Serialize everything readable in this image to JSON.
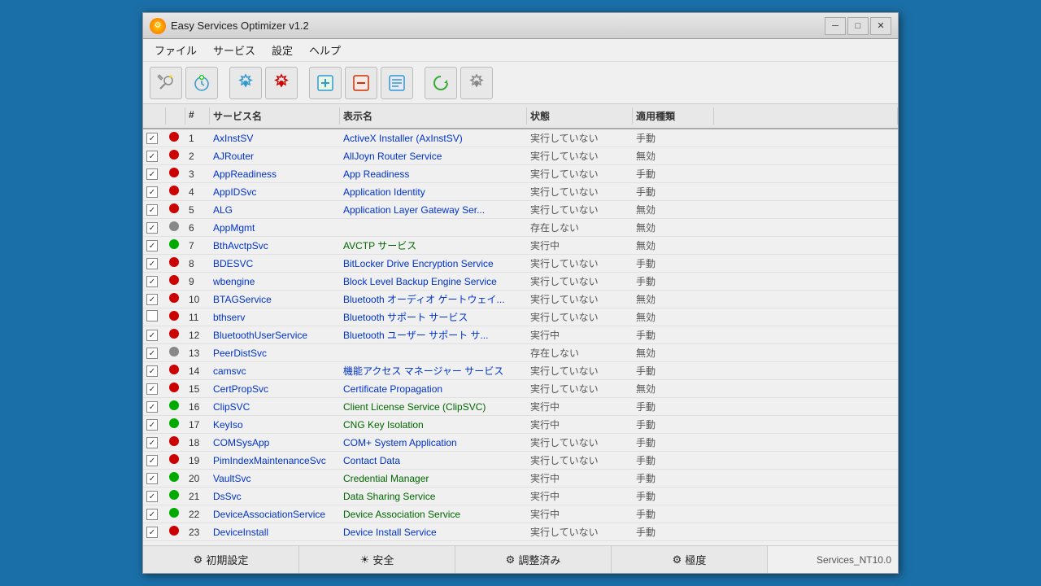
{
  "window": {
    "title": "Easy Services Optimizer v1.2",
    "icon": "⚙"
  },
  "titleButtons": {
    "minimize": "─",
    "maximize": "□",
    "close": "✕"
  },
  "menu": {
    "items": [
      "ファイル",
      "サービス",
      "設定",
      "ヘルプ"
    ]
  },
  "toolbar": {
    "buttons": [
      {
        "name": "wrench-star-icon",
        "symbol": "🔧",
        "label": "optimize"
      },
      {
        "name": "clock-icon",
        "symbol": "🕐",
        "label": "schedule"
      },
      {
        "name": "settings-icon",
        "symbol": "⚙",
        "label": "settings"
      },
      {
        "name": "settings-red-icon",
        "symbol": "🔴",
        "label": "settings-red"
      },
      {
        "name": "add-icon",
        "symbol": "➕",
        "label": "add"
      },
      {
        "name": "remove-icon",
        "symbol": "➖",
        "label": "remove"
      },
      {
        "name": "list-icon",
        "symbol": "📋",
        "label": "list"
      },
      {
        "name": "refresh-icon",
        "symbol": "🔄",
        "label": "refresh"
      },
      {
        "name": "gear-icon",
        "symbol": "⚙",
        "label": "gear"
      }
    ]
  },
  "table": {
    "headers": [
      "",
      "",
      "#",
      "サービス名",
      "表示名",
      "状態",
      "適用種類",
      ""
    ],
    "rows": [
      {
        "checked": true,
        "dot": "red",
        "num": "1",
        "service": "AxInstSV",
        "display": "ActiveX Installer (AxInstSV)",
        "status": "実行していない",
        "type": "手動",
        "green": false
      },
      {
        "checked": true,
        "dot": "red",
        "num": "2",
        "service": "AJRouter",
        "display": "AllJoyn Router Service",
        "status": "実行していない",
        "type": "無効",
        "green": false
      },
      {
        "checked": true,
        "dot": "red",
        "num": "3",
        "service": "AppReadiness",
        "display": "App Readiness",
        "status": "実行していない",
        "type": "手動",
        "green": false
      },
      {
        "checked": true,
        "dot": "red",
        "num": "4",
        "service": "AppIDSvc",
        "display": "Application Identity",
        "status": "実行していない",
        "type": "手動",
        "green": false
      },
      {
        "checked": true,
        "dot": "red",
        "num": "5",
        "service": "ALG",
        "display": "Application Layer Gateway Ser...",
        "status": "実行していない",
        "type": "無効",
        "green": false
      },
      {
        "checked": true,
        "dot": "gray",
        "num": "6",
        "service": "AppMgmt",
        "display": "",
        "status": "存在しない",
        "type": "無効",
        "green": false
      },
      {
        "checked": true,
        "dot": "green",
        "num": "7",
        "service": "BthAvctpSvc",
        "display": "AVCTP サービス",
        "status": "実行中",
        "type": "無効",
        "green": true
      },
      {
        "checked": true,
        "dot": "red",
        "num": "8",
        "service": "BDESVC",
        "display": "BitLocker Drive Encryption Service",
        "status": "実行していない",
        "type": "手動",
        "green": false
      },
      {
        "checked": true,
        "dot": "red",
        "num": "9",
        "service": "wbengine",
        "display": "Block Level Backup Engine Service",
        "status": "実行していない",
        "type": "手動",
        "green": false
      },
      {
        "checked": true,
        "dot": "red",
        "num": "10",
        "service": "BTAGService",
        "display": "Bluetooth オーディオ ゲートウェイ...",
        "status": "実行していない",
        "type": "無効",
        "green": false
      },
      {
        "checked": false,
        "dot": "red",
        "num": "11",
        "service": "bthserv",
        "display": "Bluetooth サポート サービス",
        "status": "実行していない",
        "type": "無効",
        "green": false
      },
      {
        "checked": true,
        "dot": "red",
        "num": "12",
        "service": "BluetoothUserService",
        "display": "Bluetooth ユーザー サポート サ...",
        "status": "実行中",
        "type": "手動",
        "green": false
      },
      {
        "checked": true,
        "dot": "gray",
        "num": "13",
        "service": "PeerDistSvc",
        "display": "",
        "status": "存在しない",
        "type": "無効",
        "green": false
      },
      {
        "checked": true,
        "dot": "red",
        "num": "14",
        "service": "camsvc",
        "display": "機能アクセス マネージャー サービス",
        "status": "実行していない",
        "type": "手動",
        "green": false
      },
      {
        "checked": true,
        "dot": "red",
        "num": "15",
        "service": "CertPropSvc",
        "display": "Certificate Propagation",
        "status": "実行していない",
        "type": "無効",
        "green": false
      },
      {
        "checked": true,
        "dot": "green",
        "num": "16",
        "service": "ClipSVC",
        "display": "Client License Service (ClipSVC)",
        "status": "実行中",
        "type": "手動",
        "green": true
      },
      {
        "checked": true,
        "dot": "green",
        "num": "17",
        "service": "KeyIso",
        "display": "CNG Key Isolation",
        "status": "実行中",
        "type": "手動",
        "green": true
      },
      {
        "checked": true,
        "dot": "red",
        "num": "18",
        "service": "COMSysApp",
        "display": "COM+ System Application",
        "status": "実行していない",
        "type": "手動",
        "green": false
      },
      {
        "checked": true,
        "dot": "red",
        "num": "19",
        "service": "PimIndexMaintenanceSvc",
        "display": "Contact Data",
        "status": "実行していない",
        "type": "手動",
        "green": false
      },
      {
        "checked": true,
        "dot": "green",
        "num": "20",
        "service": "VaultSvc",
        "display": "Credential Manager",
        "status": "実行中",
        "type": "手動",
        "green": true
      },
      {
        "checked": true,
        "dot": "green",
        "num": "21",
        "service": "DsSvc",
        "display": "Data Sharing Service",
        "status": "実行中",
        "type": "手動",
        "green": true
      },
      {
        "checked": true,
        "dot": "green",
        "num": "22",
        "service": "DeviceAssociationService",
        "display": "Device Association Service",
        "status": "実行中",
        "type": "手動",
        "green": true
      },
      {
        "checked": true,
        "dot": "red",
        "num": "23",
        "service": "DeviceInstall",
        "display": "Device Install Service",
        "status": "実行していない",
        "type": "手動",
        "green": false
      }
    ]
  },
  "statusBar": {
    "buttons": [
      "初期設定",
      "安全",
      "調整済み",
      "極度"
    ],
    "info": "Services_NT10.0"
  }
}
